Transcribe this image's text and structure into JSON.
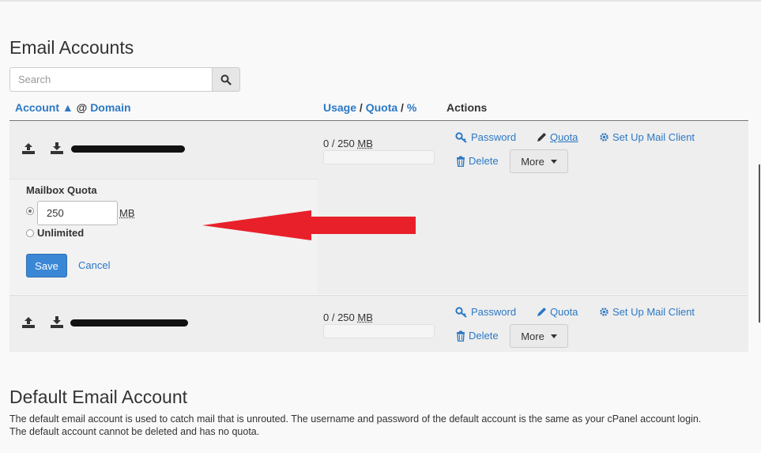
{
  "page": {
    "title": "Email Accounts"
  },
  "search": {
    "placeholder": "Search"
  },
  "table": {
    "headers": {
      "account": "Account",
      "sort_indicator": "▲",
      "at": "@",
      "domain": "Domain",
      "usage": "Usage",
      "slash1": "/",
      "quota": "Quota",
      "slash2": "/",
      "percent": "%",
      "actions": "Actions"
    },
    "rows": [
      {
        "usage_text": "0 / 250",
        "usage_unit": "MB",
        "usage_fraction": 0,
        "actions": {
          "password": "Password",
          "quota": "Quota",
          "setup": "Set Up Mail Client",
          "delete": "Delete",
          "more": "More"
        }
      },
      {
        "usage_text": "0 / 250",
        "usage_unit": "MB",
        "usage_fraction": 0,
        "actions": {
          "password": "Password",
          "quota": "Quota",
          "setup": "Set Up Mail Client",
          "delete": "Delete",
          "more": "More"
        }
      }
    ]
  },
  "quota_editor": {
    "label": "Mailbox Quota",
    "value": "250",
    "unit": "MB",
    "unlimited_label": "Unlimited",
    "save_label": "Save",
    "cancel_label": "Cancel"
  },
  "default_account": {
    "title": "Default Email Account",
    "description_line1": "The default email account is used to catch mail that is unrouted. The username and password of the default account is the same as your cPanel account login.",
    "description_line2": "The default account cannot be deleted and has no quota."
  },
  "colors": {
    "link": "#2b78c5",
    "primary_button": "#3a87d6",
    "annotation_arrow": "#e8202a"
  }
}
